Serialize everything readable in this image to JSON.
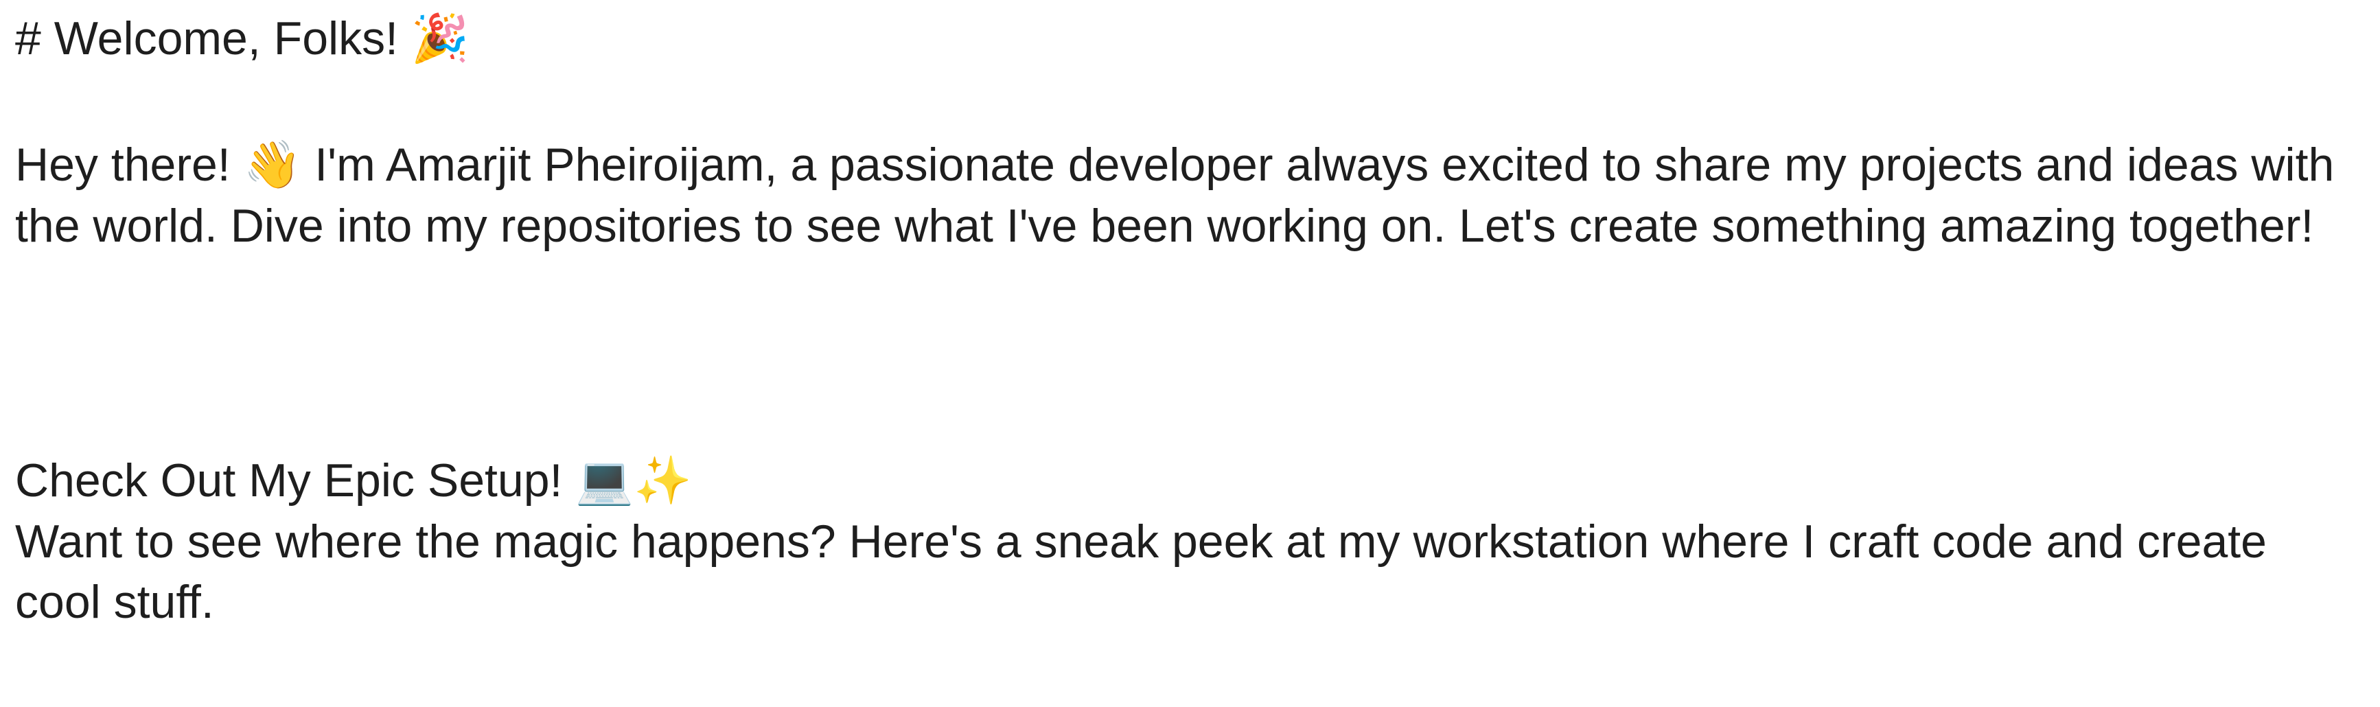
{
  "title": {
    "text": "# Welcome, Folks!",
    "emoji": "🎉",
    "emoji_icon": "party-popper-icon"
  },
  "intro": {
    "before_emoji": "Hey there!",
    "emoji": "👋",
    "emoji_icon": "waving-hand-icon",
    "after_emoji": "I'm Amarjit Pheiroijam, a passionate developer always excited to share my projects and ideas with the world. Dive into my repositories to see what I've been working on. Let's create something amazing together!"
  },
  "setup": {
    "heading": "Check Out My Epic Setup!",
    "emoji": "💻✨",
    "emoji_icons": [
      "laptop-icon",
      "sparkles-icon"
    ],
    "body": "Want to see where the magic happens? Here's a sneak peek at my workstation where I craft code and create cool stuff."
  },
  "colors": {
    "text": "#1e1e1e",
    "background": "#ffffff"
  }
}
